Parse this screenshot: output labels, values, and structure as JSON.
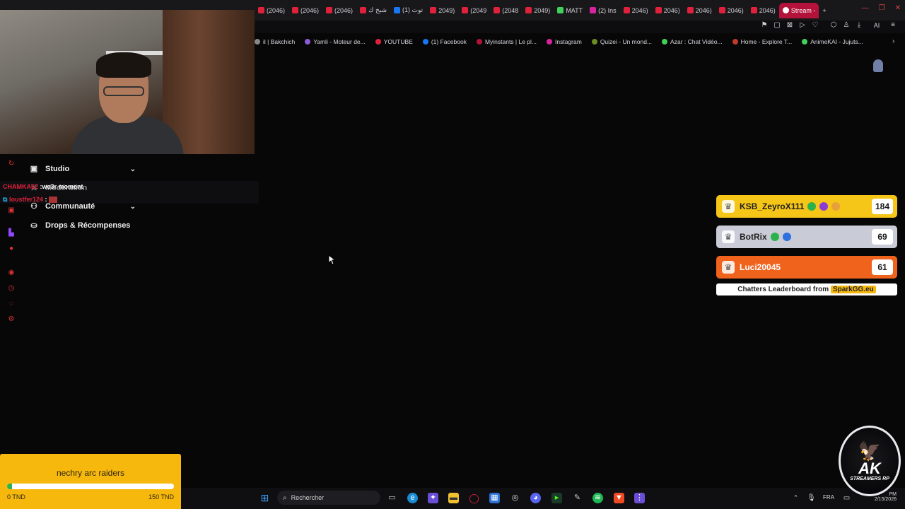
{
  "browser": {
    "tabs": [
      {
        "label": "(2046)",
        "color": "#e0213b"
      },
      {
        "label": "(2046)",
        "color": "#e0213b"
      },
      {
        "label": "(2046)",
        "color": "#e0213b"
      },
      {
        "label": "شيخ ك",
        "color": "#e0213b"
      },
      {
        "label": "(1) توت",
        "color": "#1877f2"
      },
      {
        "label": "2049)",
        "color": "#e0213b"
      },
      {
        "label": "(2049",
        "color": "#e0213b"
      },
      {
        "label": "(2048",
        "color": "#e0213b"
      },
      {
        "label": "2049)",
        "color": "#e0213b"
      },
      {
        "label": "MATT",
        "color": "#3fd15a"
      },
      {
        "label": "(2) Ins",
        "color": "#d6249f"
      },
      {
        "label": "2046)",
        "color": "#e0213b"
      },
      {
        "label": "2046)",
        "color": "#e0213b"
      },
      {
        "label": "2046)",
        "color": "#e0213b"
      },
      {
        "label": "2046)",
        "color": "#e0213b"
      },
      {
        "label": "2046)",
        "color": "#e0213b"
      }
    ],
    "active_tab": {
      "label": "Stream -"
    },
    "new_tab": "+",
    "bookmarks": [
      {
        "label": "il | Bakchich",
        "color": "#888"
      },
      {
        "label": "Yamli - Moteur de...",
        "color": "#8c5bd6"
      },
      {
        "label": "YOUTUBE",
        "color": "#e0213b"
      },
      {
        "label": "(1) Facebook",
        "color": "#1877f2"
      },
      {
        "label": "Myinstants | Le pl...",
        "color": "#b3123a"
      },
      {
        "label": "Instagram",
        "color": "#d6249f"
      },
      {
        "label": "Quizei - Un mond...",
        "color": "#6b8e23"
      },
      {
        "label": "Azar : Chat Vidéo...",
        "color": "#3fd15a"
      },
      {
        "label": "Home - Explore T...",
        "color": "#c0392b"
      },
      {
        "label": "AnimeKAI - Jujuts...",
        "color": "#3fd15a"
      }
    ],
    "ai_label": "AI"
  },
  "chat": [
    {
      "user": "CHAMKA02",
      "message": ":we3r moment",
      "user_color": "#e0213b"
    },
    {
      "user": "loustfer124",
      "message": ":",
      "user_color": "#e0213b"
    }
  ],
  "menu": {
    "studio": "Studio",
    "moderation": "Modération",
    "communaute": "Communauté",
    "drops": "Drops & Récompenses"
  },
  "leaderboard": {
    "rows": [
      {
        "name": "KSB_ZeyroX111",
        "score": "184",
        "color": "#f5c518"
      },
      {
        "name": "BotRix",
        "score": "69",
        "color": "#c9ccd6"
      },
      {
        "name": "Luci20045",
        "score": "61",
        "color": "#f0631c"
      }
    ],
    "footer_text": "Chatters Leaderboard from",
    "footer_brand": "SparkGG.eu"
  },
  "goal": {
    "title": "nechry arc raiders",
    "min_label": "0 TND",
    "max_label": "150 TND",
    "progress": 0.03
  },
  "taskbar": {
    "search_placeholder": "Rechercher",
    "lang": "FRA",
    "time": "PM",
    "date": "2/15/2026"
  },
  "logo": {
    "text": "AK",
    "subtext": "STREAMERS RP"
  }
}
